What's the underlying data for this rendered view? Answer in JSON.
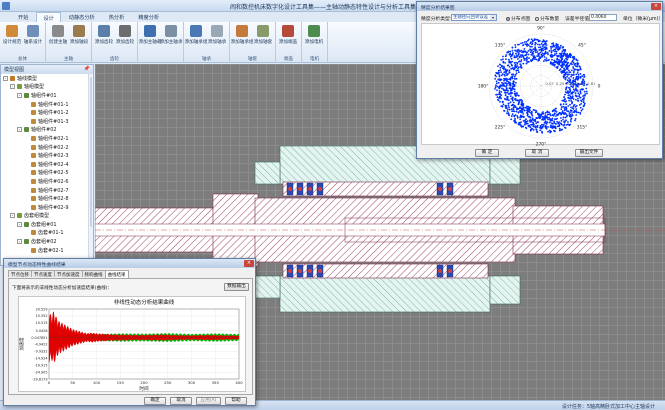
{
  "window": {
    "title": "闹和数控机床数字化设计工具集——主轴动静态特性设计与分析工具集"
  },
  "tabs": [
    {
      "label": "开始",
      "active": false
    },
    {
      "label": "设计",
      "active": true
    },
    {
      "label": "动静态分析",
      "active": false
    },
    {
      "label": "热分析",
      "active": false
    },
    {
      "label": "精度分析",
      "active": false
    }
  ],
  "ribbon": {
    "groups": [
      {
        "label": "总体",
        "buttons": [
          {
            "label": "设计规范",
            "icon": "ruler-icon",
            "color": "#d08a3a"
          },
          {
            "label": "轴系设计",
            "icon": "shaft-icon",
            "color": "#6f8fb8"
          }
        ]
      },
      {
        "label": "主轴",
        "buttons": [
          {
            "label": "创建主轴",
            "icon": "spindle-icon",
            "color": "#8a8a8a"
          },
          {
            "label": "添加轴段",
            "icon": "shaft-segment-icon",
            "color": "#9a7b4f"
          }
        ]
      },
      {
        "label": "齿轮",
        "buttons": [
          {
            "label": "添加齿轮",
            "icon": "gear-icon",
            "color": "#5a7fa8"
          },
          {
            "label": "添加齿轮",
            "icon": "gear-add-icon",
            "color": "#6d6d6d"
          }
        ]
      },
      {
        "label": "",
        "buttons": [
          {
            "label": "添加主轴载",
            "icon": "load-icon",
            "color": "#3f6fb0"
          },
          {
            "label": "添加主轴承",
            "icon": "bearing-icon",
            "color": "#7d8fa3"
          }
        ]
      },
      {
        "label": "轴承",
        "buttons": [
          {
            "label": "添加轴承组",
            "icon": "bearing-group-icon",
            "color": "#4a78b5"
          },
          {
            "label": "添加轴承",
            "icon": "bearing-add-icon",
            "color": "#9aa7b5"
          }
        ]
      },
      {
        "label": "轴套",
        "buttons": [
          {
            "label": "添加轴承组",
            "icon": "sleeve-group-icon",
            "color": "#c47a3a"
          },
          {
            "label": "添加轴套",
            "icon": "sleeve-icon",
            "color": "#8a9b6a"
          }
        ]
      },
      {
        "label": "端盖",
        "buttons": [
          {
            "label": "添加端盖",
            "icon": "end-cap-icon",
            "color": "#b54a3a"
          }
        ]
      },
      {
        "label": "电机",
        "buttons": [
          {
            "label": "添加电机",
            "icon": "motor-icon",
            "color": "#4f8a4f"
          }
        ]
      }
    ]
  },
  "left_panel": {
    "title": "模型视图",
    "pin": "📌",
    "tree": [
      {
        "label": "轴线模型",
        "level": 0,
        "expander": "-",
        "color": "#c07a2a"
      },
      {
        "label": "轴组模型",
        "level": 1,
        "expander": "-",
        "color": "#7a9a3a"
      },
      {
        "label": "轴组件#01",
        "level": 2,
        "expander": "-",
        "color": "#5a8a3a"
      },
      {
        "label": "轴组件#01-1",
        "level": 3,
        "expander": "",
        "color": "#c08a3a"
      },
      {
        "label": "轴组件#01-2",
        "level": 3,
        "expander": "",
        "color": "#c08a3a"
      },
      {
        "label": "轴组件#01-3",
        "level": 3,
        "expander": "",
        "color": "#c08a3a"
      },
      {
        "label": "轴组件#02",
        "level": 2,
        "expander": "-",
        "color": "#5a8a3a"
      },
      {
        "label": "轴组件#02-1",
        "level": 3,
        "expander": "",
        "color": "#c08a3a"
      },
      {
        "label": "轴组件#02-2",
        "level": 3,
        "expander": "",
        "color": "#c08a3a"
      },
      {
        "label": "轴组件#02-3",
        "level": 3,
        "expander": "",
        "color": "#c08a3a"
      },
      {
        "label": "轴组件#02-4",
        "level": 3,
        "expander": "",
        "color": "#c08a3a"
      },
      {
        "label": "轴组件#02-5",
        "level": 3,
        "expander": "",
        "color": "#c08a3a"
      },
      {
        "label": "轴组件#02-6",
        "level": 3,
        "expander": "",
        "color": "#c08a3a"
      },
      {
        "label": "轴组件#02-7",
        "level": 3,
        "expander": "",
        "color": "#c08a3a"
      },
      {
        "label": "轴组件#02-8",
        "level": 3,
        "expander": "",
        "color": "#c08a3a"
      },
      {
        "label": "轴组件#02-9",
        "level": 3,
        "expander": "",
        "color": "#c08a3a"
      },
      {
        "label": "齿套组模型",
        "level": 1,
        "expander": "-",
        "color": "#7a9a3a"
      },
      {
        "label": "齿套组#01",
        "level": 2,
        "expander": "-",
        "color": "#5a8a3a"
      },
      {
        "label": "齿套#01-1",
        "level": 3,
        "expander": "",
        "color": "#c08a3a"
      },
      {
        "label": "齿套组#02",
        "level": 2,
        "expander": "-",
        "color": "#5a8a3a"
      },
      {
        "label": "齿套#02-1",
        "level": 3,
        "expander": "",
        "color": "#c08a3a"
      }
    ]
  },
  "status_bar": {
    "text": "设计任务：5轴高精卧式加工中心主轴设计"
  },
  "polar_dialog": {
    "title": "精度分析结果图",
    "type_label": "精度分析类型：",
    "type_value": "主轴径向回转误差",
    "radio_dist": "分布点图",
    "radio_count": "分布数量",
    "radio_selected": "distribution",
    "limit_label": "误差半径值",
    "limit_value": "0.4060",
    "unit_label": "单位（微米(μm)）",
    "buttons": {
      "ok": "确 定",
      "cancel": "取 消",
      "export": "输出文件"
    },
    "angle_labels": [
      "90°",
      "45°",
      "0",
      "315°",
      "270°",
      "225°",
      "180°",
      "135°"
    ],
    "ring_labels": [
      "0.81",
      "0.63",
      "0.44",
      "0.25",
      "0.07"
    ]
  },
  "curve_dialog": {
    "title": "模型节点动态特性曲线结果",
    "subtabs": [
      {
        "label": "节点位移",
        "active": false
      },
      {
        "label": "节点速度",
        "active": false
      },
      {
        "label": "节点加速度",
        "active": false
      },
      {
        "label": "频响曲线",
        "active": false
      },
      {
        "label": "曲线结果",
        "active": true
      }
    ],
    "hint": "下面将表示的非线性动态分析加速度结果(曲线)：",
    "export_button": "数据输出",
    "buttons": {
      "ok": "确定",
      "cancel": "取消",
      "apply": "应用(A)",
      "help": "帮助"
    }
  },
  "chart_data": {
    "type": "line",
    "title": "非线性动态分析结果曲线",
    "xlabel": "时间",
    "ylabel": "加速度",
    "xlim": [
      0,
      400
    ],
    "ylim": [
      -29.8179,
      20.529
    ],
    "xticks": [
      0,
      50,
      100,
      150,
      200,
      250,
      300,
      350,
      400
    ],
    "yticks": [
      20.529,
      15.552,
      10.515,
      5.0428,
      0.047851,
      -4.9422,
      -9.9332,
      -14.924,
      -19.915,
      -24.905,
      -29.8179
    ],
    "ytick_labels": [
      "20.529",
      "15.552",
      "10.515",
      "5.0428",
      "0.047851",
      "-4.9422",
      "-9.9332",
      "-14.924",
      "-19.915",
      "-24.905",
      "-29.8179"
    ],
    "series": [
      {
        "color": "#e00000",
        "envelope": [
          [
            0,
            18
          ],
          [
            5,
            16
          ],
          [
            10,
            19
          ],
          [
            15,
            15
          ],
          [
            20,
            12
          ],
          [
            30,
            10
          ],
          [
            40,
            8
          ],
          [
            50,
            6
          ],
          [
            60,
            5
          ],
          [
            70,
            4
          ],
          [
            80,
            3
          ],
          [
            90,
            3.5
          ],
          [
            100,
            3
          ],
          [
            120,
            2.5
          ],
          [
            140,
            2.2
          ],
          [
            160,
            2
          ],
          [
            180,
            1.8
          ],
          [
            200,
            1.8
          ],
          [
            220,
            2
          ],
          [
            240,
            2.2
          ],
          [
            260,
            1.8
          ],
          [
            280,
            1.6
          ],
          [
            300,
            1.5
          ],
          [
            320,
            1.7
          ],
          [
            340,
            1.8
          ],
          [
            360,
            1.6
          ],
          [
            380,
            1.4
          ],
          [
            400,
            1.3
          ]
        ]
      },
      {
        "color": "#00b000",
        "envelope": [
          [
            0,
            2
          ],
          [
            50,
            2.2
          ],
          [
            100,
            2.5
          ],
          [
            150,
            3
          ],
          [
            200,
            2.8
          ],
          [
            250,
            3.2
          ],
          [
            300,
            2.6
          ],
          [
            350,
            3
          ],
          [
            400,
            2.5
          ]
        ]
      }
    ]
  }
}
